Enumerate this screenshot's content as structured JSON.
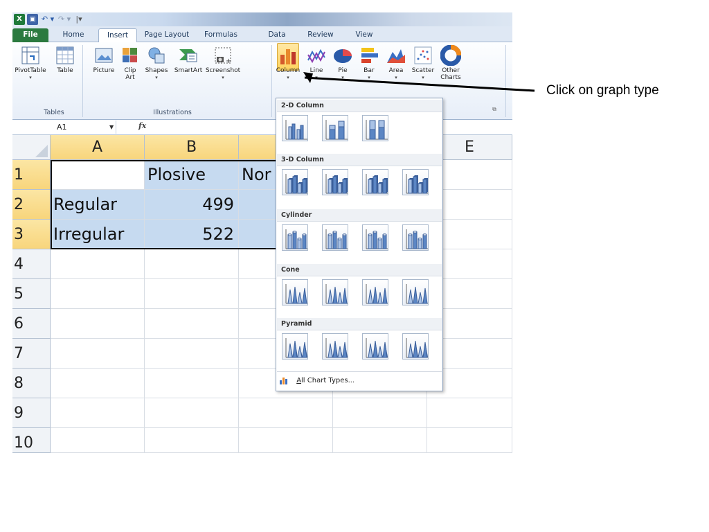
{
  "quick_access": {
    "app_icon": "X",
    "save_icon": "save-icon",
    "undo_glyph": "↶ ▾",
    "redo_glyph": "↷ ▾",
    "customize_glyph": "|▾"
  },
  "tabs": [
    {
      "label": "File"
    },
    {
      "label": "Home"
    },
    {
      "label": "Insert"
    },
    {
      "label": "Page Layout"
    },
    {
      "label": "Formulas"
    },
    {
      "label": "Data"
    },
    {
      "label": "Review"
    },
    {
      "label": "View"
    }
  ],
  "active_tab": "Insert",
  "ribbon": {
    "groups": {
      "tables": "Tables",
      "illustrations": "Illustrations"
    },
    "buttons": {
      "pivottable": "PivotTable",
      "table": "Table",
      "picture": "Picture",
      "clip_art_1": "Clip",
      "clip_art_2": "Art",
      "shapes": "Shapes",
      "smartart": "SmartArt",
      "screenshot": "Screenshot",
      "column": "Column",
      "line": "Line",
      "pie": "Pie",
      "bar": "Bar",
      "area": "Area",
      "scatter": "Scatter",
      "other_1": "Other",
      "other_2": "Charts"
    },
    "dropdown_glyph": "▾",
    "launcher_glyph": "⧉"
  },
  "formula_bar": {
    "name_box": "A1",
    "fx_label": "fx",
    "value": ""
  },
  "sheet": {
    "columns": [
      "A",
      "B",
      "",
      "",
      "E"
    ],
    "rows": [
      "1",
      "2",
      "3",
      "4",
      "5",
      "6",
      "7",
      "8",
      "9",
      "10"
    ],
    "cells": {
      "B1": "Plosive",
      "C1": "Nor",
      "A2": "Regular",
      "B2": "499",
      "A3": "Irregular",
      "B3": "522"
    }
  },
  "gallery": {
    "sections": [
      "2-D Column",
      "3-D Column",
      "Cylinder",
      "Cone",
      "Pyramid"
    ],
    "all_chart_types_prefix": "A",
    "all_chart_types_rest": "ll Chart Types..."
  },
  "annotation": {
    "text": "Click on graph type"
  },
  "colors": {
    "selection": "#c6daf0",
    "header_selected": "#f8d57c",
    "file_tab": "#2b7a3f",
    "column_button_highlight": "#ffd45e"
  }
}
